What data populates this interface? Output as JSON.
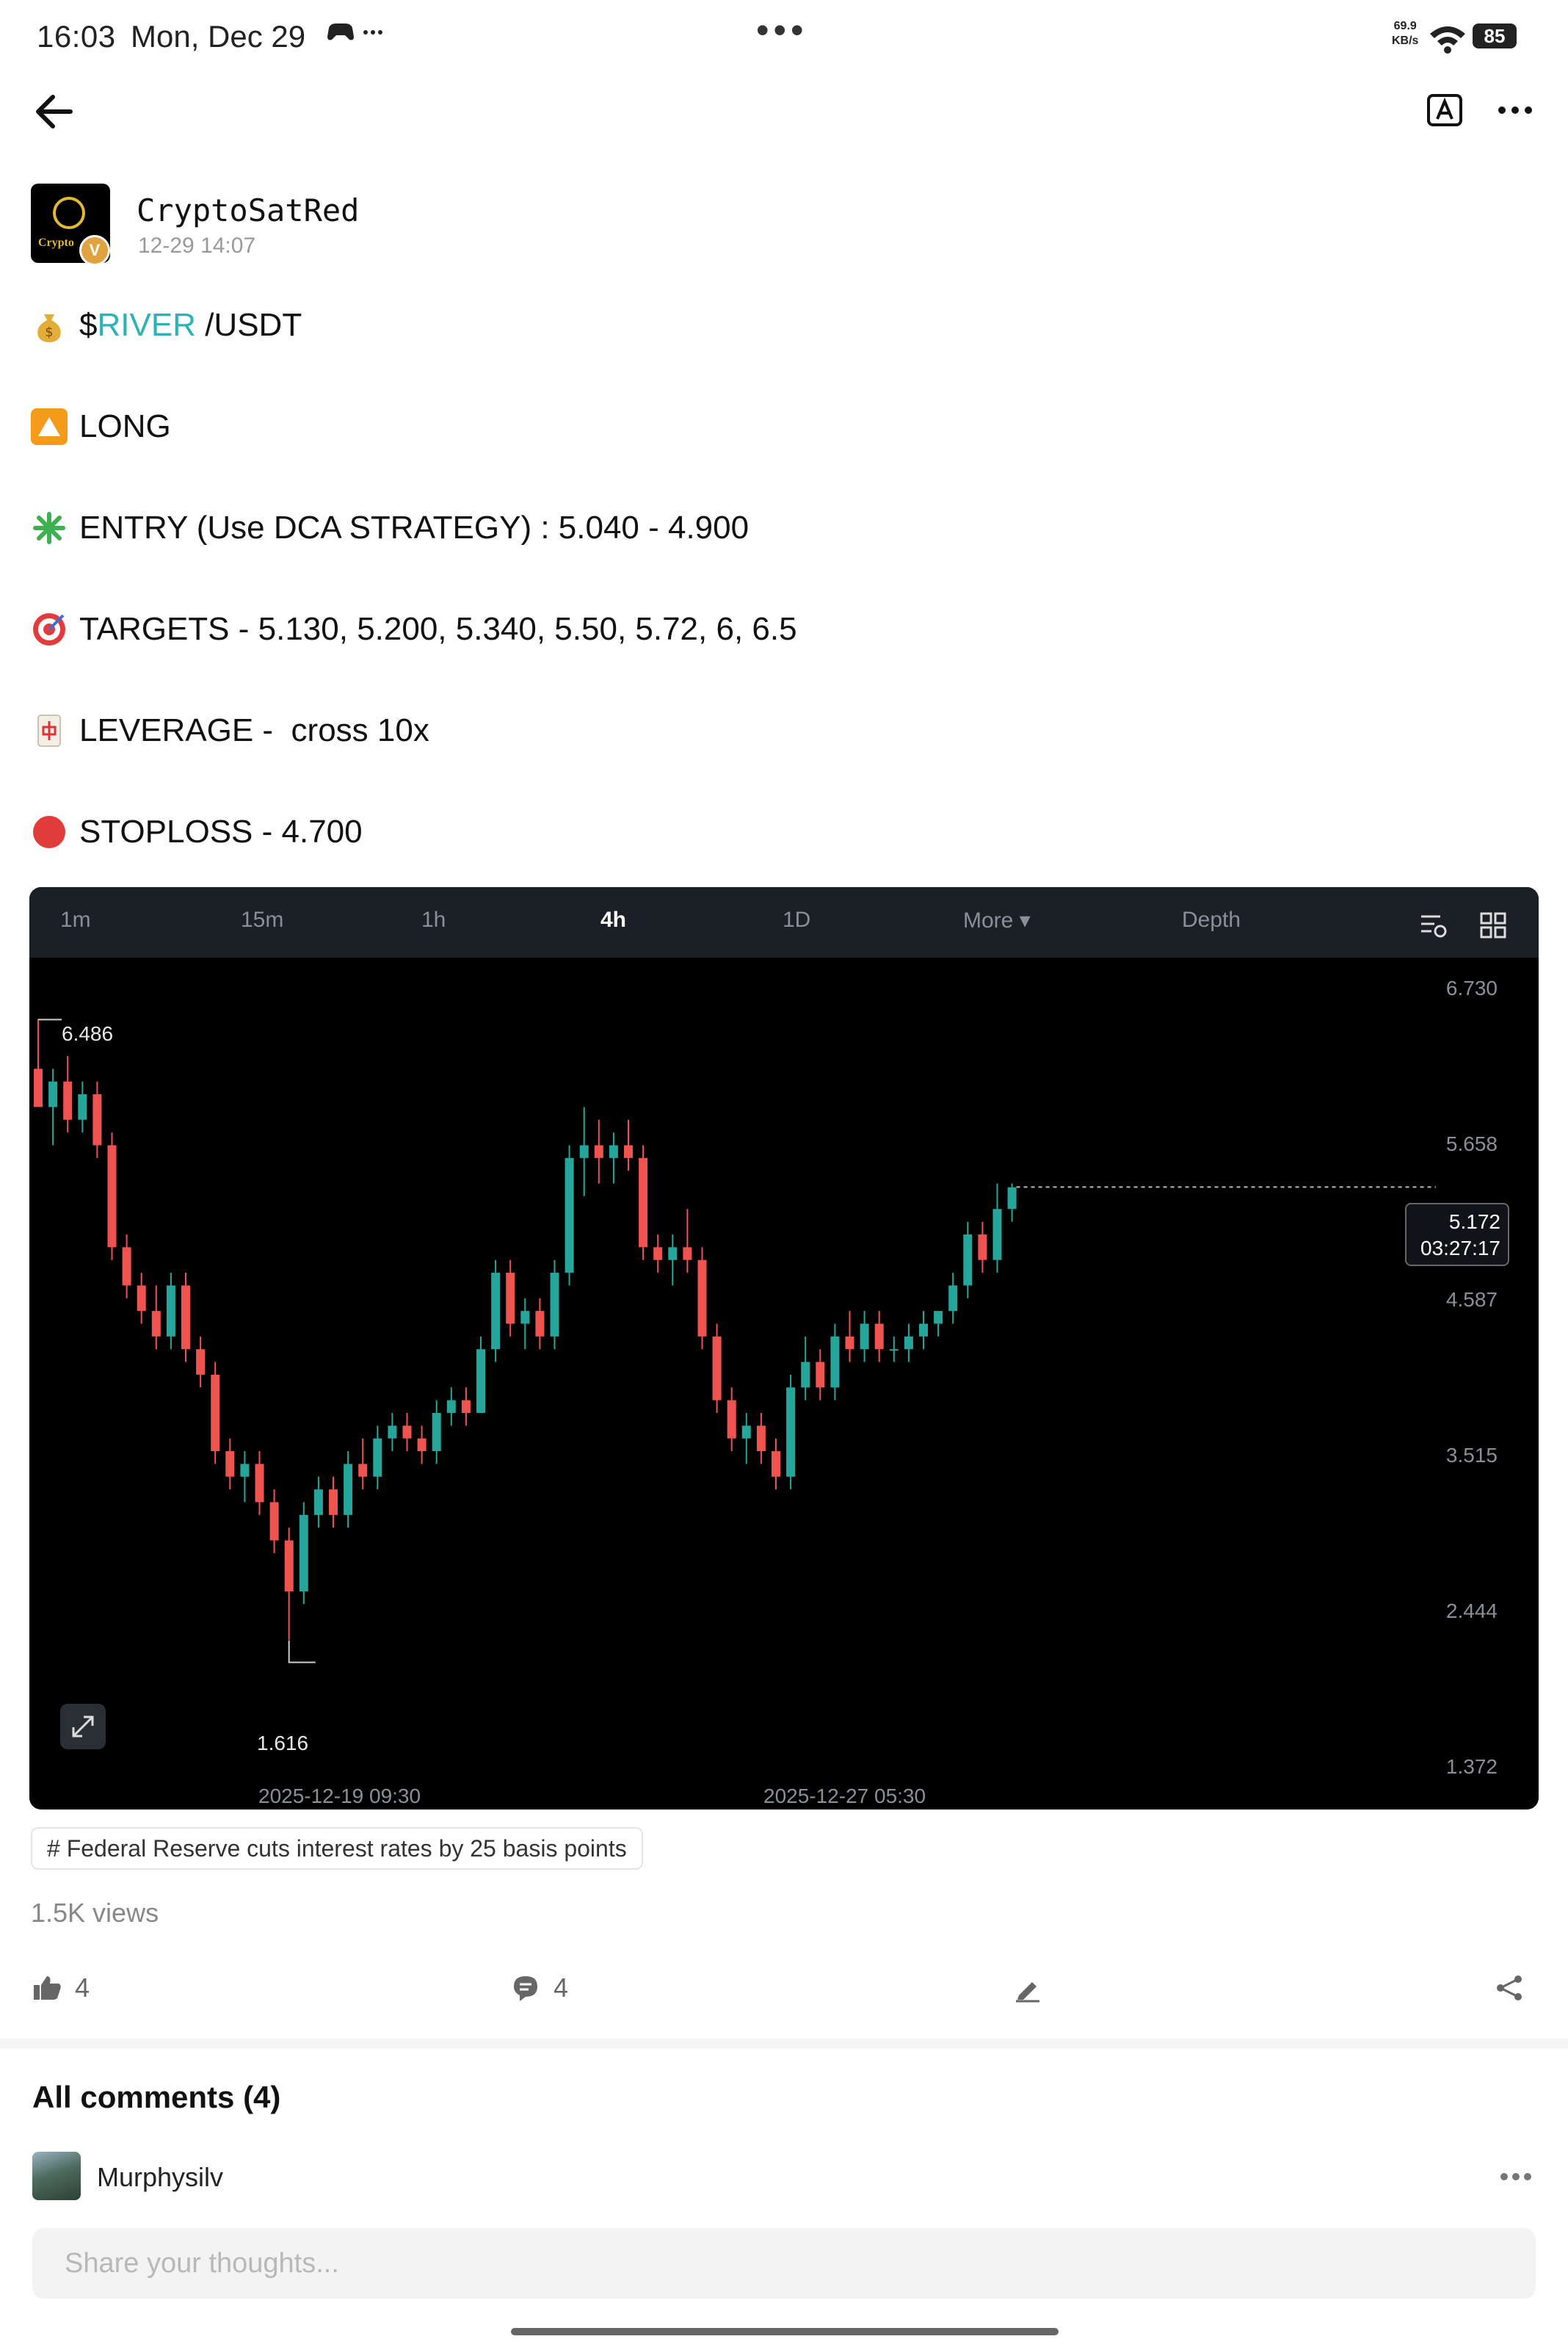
{
  "status_bar": {
    "time": "16:03",
    "date": "Mon, Dec 29",
    "extra": "…",
    "speed_value": "69.9",
    "speed_unit": "KB/s",
    "battery": "85"
  },
  "nav": {
    "icons": [
      "back-arrow-icon",
      "translate-icon",
      "more-icon"
    ]
  },
  "author": {
    "name": "CryptoSatRed",
    "timestamp": "12-29 14:07",
    "avatar_text": "Crypto",
    "verified_mark": "V"
  },
  "post": {
    "pair_prefix": "$",
    "ticker": "RIVER",
    "pair_suffix": " /USDT",
    "direction": "LONG",
    "entry": "ENTRY (Use DCA STRATEGY) : 5.040 - 4.900",
    "targets": "TARGETS - 5.130, 5.200, 5.340, 5.50, 5.72, 6, 6.5",
    "leverage": "LEVERAGE -  cross 10x",
    "stoploss": "STOPLOSS - 4.700"
  },
  "chart_toolbar": {
    "tabs": [
      "1m",
      "15m",
      "1h",
      "4h",
      "1D",
      "More ▾",
      "Depth"
    ],
    "active_tab": "4h"
  },
  "chart_data": {
    "type": "candlestick",
    "interval": "4h",
    "y_ticks": [
      "6.730",
      "5.658",
      "4.587",
      "3.515",
      "2.444",
      "1.372"
    ],
    "ylim": [
      1.372,
      6.73
    ],
    "x_ticks": [
      "2025-12-19 09:30",
      "2025-12-27 05:30"
    ],
    "high_label": "6.486",
    "low_label": "1.616",
    "current_price": "5.172",
    "countdown": "03:27:17",
    "up_color": "#26a69a",
    "down_color": "#ef5350",
    "candles": [
      [
        6.1,
        6.49,
        5.8,
        5.8
      ],
      [
        5.8,
        6.1,
        5.5,
        6.0
      ],
      [
        6.0,
        6.2,
        5.6,
        5.7
      ],
      [
        5.7,
        6.0,
        5.6,
        5.9
      ],
      [
        5.9,
        6.0,
        5.4,
        5.5
      ],
      [
        5.5,
        5.6,
        4.6,
        4.7
      ],
      [
        4.7,
        4.8,
        4.3,
        4.4
      ],
      [
        4.4,
        4.5,
        4.1,
        4.2
      ],
      [
        4.2,
        4.4,
        3.9,
        4.0
      ],
      [
        4.0,
        4.5,
        3.9,
        4.4
      ],
      [
        4.4,
        4.5,
        3.8,
        3.9
      ],
      [
        3.9,
        4.0,
        3.6,
        3.7
      ],
      [
        3.7,
        3.8,
        3.0,
        3.1
      ],
      [
        3.1,
        3.2,
        2.8,
        2.9
      ],
      [
        2.9,
        3.1,
        2.7,
        3.0
      ],
      [
        3.0,
        3.1,
        2.6,
        2.7
      ],
      [
        2.7,
        2.8,
        2.3,
        2.4
      ],
      [
        2.4,
        2.5,
        1.62,
        2.0
      ],
      [
        2.0,
        2.7,
        1.9,
        2.6
      ],
      [
        2.6,
        2.9,
        2.5,
        2.8
      ],
      [
        2.8,
        2.9,
        2.5,
        2.6
      ],
      [
        2.6,
        3.1,
        2.5,
        3.0
      ],
      [
        3.0,
        3.2,
        2.8,
        2.9
      ],
      [
        2.9,
        3.3,
        2.8,
        3.2
      ],
      [
        3.2,
        3.4,
        3.1,
        3.3
      ],
      [
        3.3,
        3.4,
        3.1,
        3.2
      ],
      [
        3.2,
        3.3,
        3.0,
        3.1
      ],
      [
        3.1,
        3.5,
        3.0,
        3.4
      ],
      [
        3.4,
        3.6,
        3.3,
        3.5
      ],
      [
        3.5,
        3.6,
        3.3,
        3.4
      ],
      [
        3.4,
        4.0,
        3.4,
        3.9
      ],
      [
        3.9,
        4.6,
        3.8,
        4.5
      ],
      [
        4.5,
        4.6,
        4.0,
        4.1
      ],
      [
        4.1,
        4.3,
        3.9,
        4.2
      ],
      [
        4.2,
        4.3,
        3.9,
        4.0
      ],
      [
        4.0,
        4.6,
        3.9,
        4.5
      ],
      [
        4.5,
        5.5,
        4.4,
        5.4
      ],
      [
        5.4,
        5.8,
        5.1,
        5.5
      ],
      [
        5.5,
        5.7,
        5.2,
        5.4
      ],
      [
        5.4,
        5.6,
        5.2,
        5.5
      ],
      [
        5.5,
        5.7,
        5.3,
        5.4
      ],
      [
        5.4,
        5.5,
        4.6,
        4.7
      ],
      [
        4.7,
        4.8,
        4.5,
        4.6
      ],
      [
        4.6,
        4.8,
        4.4,
        4.7
      ],
      [
        4.7,
        5.0,
        4.5,
        4.6
      ],
      [
        4.6,
        4.7,
        3.9,
        4.0
      ],
      [
        4.0,
        4.1,
        3.4,
        3.5
      ],
      [
        3.5,
        3.6,
        3.1,
        3.2
      ],
      [
        3.2,
        3.4,
        3.0,
        3.3
      ],
      [
        3.3,
        3.4,
        3.0,
        3.1
      ],
      [
        3.1,
        3.2,
        2.8,
        2.9
      ],
      [
        2.9,
        3.7,
        2.8,
        3.6
      ],
      [
        3.6,
        4.0,
        3.5,
        3.8
      ],
      [
        3.8,
        3.9,
        3.5,
        3.6
      ],
      [
        3.6,
        4.1,
        3.5,
        4.0
      ],
      [
        4.0,
        4.2,
        3.8,
        3.9
      ],
      [
        3.9,
        4.2,
        3.8,
        4.1
      ],
      [
        4.1,
        4.2,
        3.8,
        3.9
      ],
      [
        3.9,
        4.0,
        3.8,
        3.9
      ],
      [
        3.9,
        4.1,
        3.8,
        4.0
      ],
      [
        4.0,
        4.2,
        3.9,
        4.1
      ],
      [
        4.1,
        4.2,
        4.0,
        4.2
      ],
      [
        4.2,
        4.5,
        4.1,
        4.4
      ],
      [
        4.4,
        4.9,
        4.3,
        4.8
      ],
      [
        4.8,
        4.9,
        4.5,
        4.6
      ],
      [
        4.6,
        5.2,
        4.5,
        5.0
      ],
      [
        5.0,
        5.2,
        4.9,
        5.17
      ]
    ]
  },
  "hashtag": {
    "symbol": "#",
    "text": "Federal Reserve cuts interest rates by 25 basis points"
  },
  "views": "1.5K views",
  "actions": {
    "likes": "4",
    "comments": "4"
  },
  "comments": {
    "title": "All comments (4)",
    "first_commenter": "Murphysilv",
    "input_placeholder": "Share your thoughts..."
  }
}
